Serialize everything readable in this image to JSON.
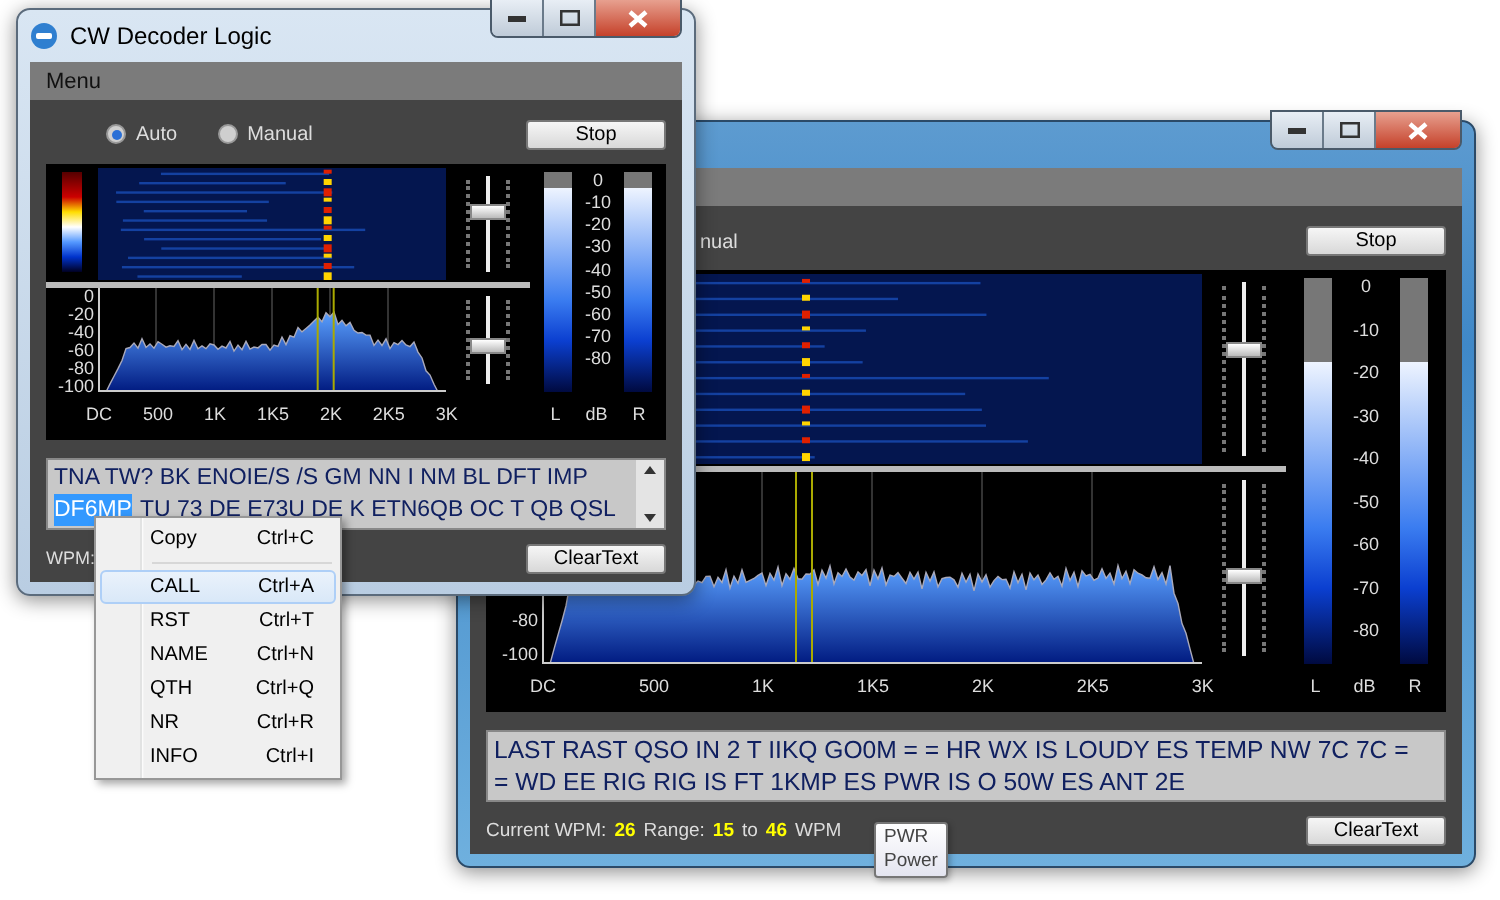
{
  "background_window": {
    "mode_label_fragment": "nual",
    "stop_button": "Stop",
    "sliders": [
      {
        "level": 0.6
      },
      {
        "level": 0.46
      }
    ],
    "spectrum_y_labels": [
      "-80",
      "-100"
    ],
    "x_labels": [
      "DC",
      "500",
      "1K",
      "1K5",
      "2K",
      "2K5",
      "3K"
    ],
    "meters": [
      {
        "label": "L",
        "level": 0.78
      },
      {
        "label": "R",
        "level": 0.78
      }
    ],
    "meter_scale": [
      "0",
      "-10",
      "-20",
      "-30",
      "-40",
      "-50",
      "-60",
      "-70",
      "-80"
    ],
    "scale_label": "dB",
    "decoded_text": {
      "lines": [
        [
          {
            "text": "LAST RAST QSO IN 2 T IIKQ GO0M = = HR WX IS LOUDY ES TEMP NW 7C 7C =",
            "selected": false
          }
        ],
        [
          {
            "text": "= WD EE RIG RIG IS FT 1KMP ES PWR IS O 50W ES ANT 2E",
            "selected": false
          }
        ]
      ]
    },
    "status": [
      {
        "text": "Current WPM:",
        "kind": "label"
      },
      {
        "text": "26",
        "kind": "value"
      },
      {
        "text": "Range:",
        "kind": "label"
      },
      {
        "text": "15",
        "kind": "value"
      },
      {
        "text": "to",
        "kind": "label"
      },
      {
        "text": "46",
        "kind": "value"
      },
      {
        "text": "WPM",
        "kind": "label"
      }
    ],
    "clear_button": "ClearText"
  },
  "decoder_window": {
    "title": "CW Decoder Logic",
    "menu": [
      "Menu"
    ],
    "mode_options": [
      {
        "label": "Auto",
        "selected": true
      },
      {
        "label": "Manual",
        "selected": false
      }
    ],
    "stop_button": "Stop",
    "sliders": [
      {
        "level": 0.6
      },
      {
        "level": 0.45
      }
    ],
    "spectrum_y_labels": [
      "0",
      "-20",
      "-40",
      "-60",
      "-80",
      "-100"
    ],
    "x_labels": [
      "DC",
      "500",
      "1K",
      "1K5",
      "2K",
      "2K5",
      "3K"
    ],
    "meters": [
      {
        "label": "L",
        "level": 0.93
      },
      {
        "label": "R",
        "level": 0.93
      }
    ],
    "meter_scale": [
      "0",
      "-10",
      "-20",
      "-30",
      "-40",
      "-50",
      "-60",
      "-70",
      "-80"
    ],
    "scale_label": "dB",
    "decoded_text": {
      "lines": [
        [
          {
            "text": "TNA TW? BK ENOIE/S /S GM NN I NM BL DFT IMP",
            "selected": false
          }
        ],
        [
          {
            "text": "DF6MP",
            "selected": true
          },
          {
            "text": "TU 73 DE E73U DE K ETN6QB OC T QB QSL",
            "selected": false
          }
        ]
      ]
    },
    "status": [
      {
        "text": "WPM:",
        "kind": "label"
      }
    ],
    "clear_button": "ClearText"
  },
  "context_menu": {
    "items": [
      {
        "kind": "item",
        "label": "Copy",
        "shortcut": "Ctrl+C",
        "selected": false
      },
      {
        "kind": "separator"
      },
      {
        "kind": "item",
        "label": "CALL",
        "shortcut": "Ctrl+A",
        "selected": true
      },
      {
        "kind": "item",
        "label": "RST",
        "shortcut": "Ctrl+T",
        "selected": false
      },
      {
        "kind": "item",
        "label": "NAME",
        "shortcut": "Ctrl+N",
        "selected": false
      },
      {
        "kind": "item",
        "label": "QTH",
        "shortcut": "Ctrl+Q",
        "selected": false
      },
      {
        "kind": "item",
        "label": "NR",
        "shortcut": "Ctrl+R",
        "selected": false
      },
      {
        "kind": "item",
        "label": "INFO",
        "shortcut": "Ctrl+I",
        "selected": false
      }
    ]
  },
  "tooltip": {
    "title": "PWR",
    "text": "Power"
  }
}
